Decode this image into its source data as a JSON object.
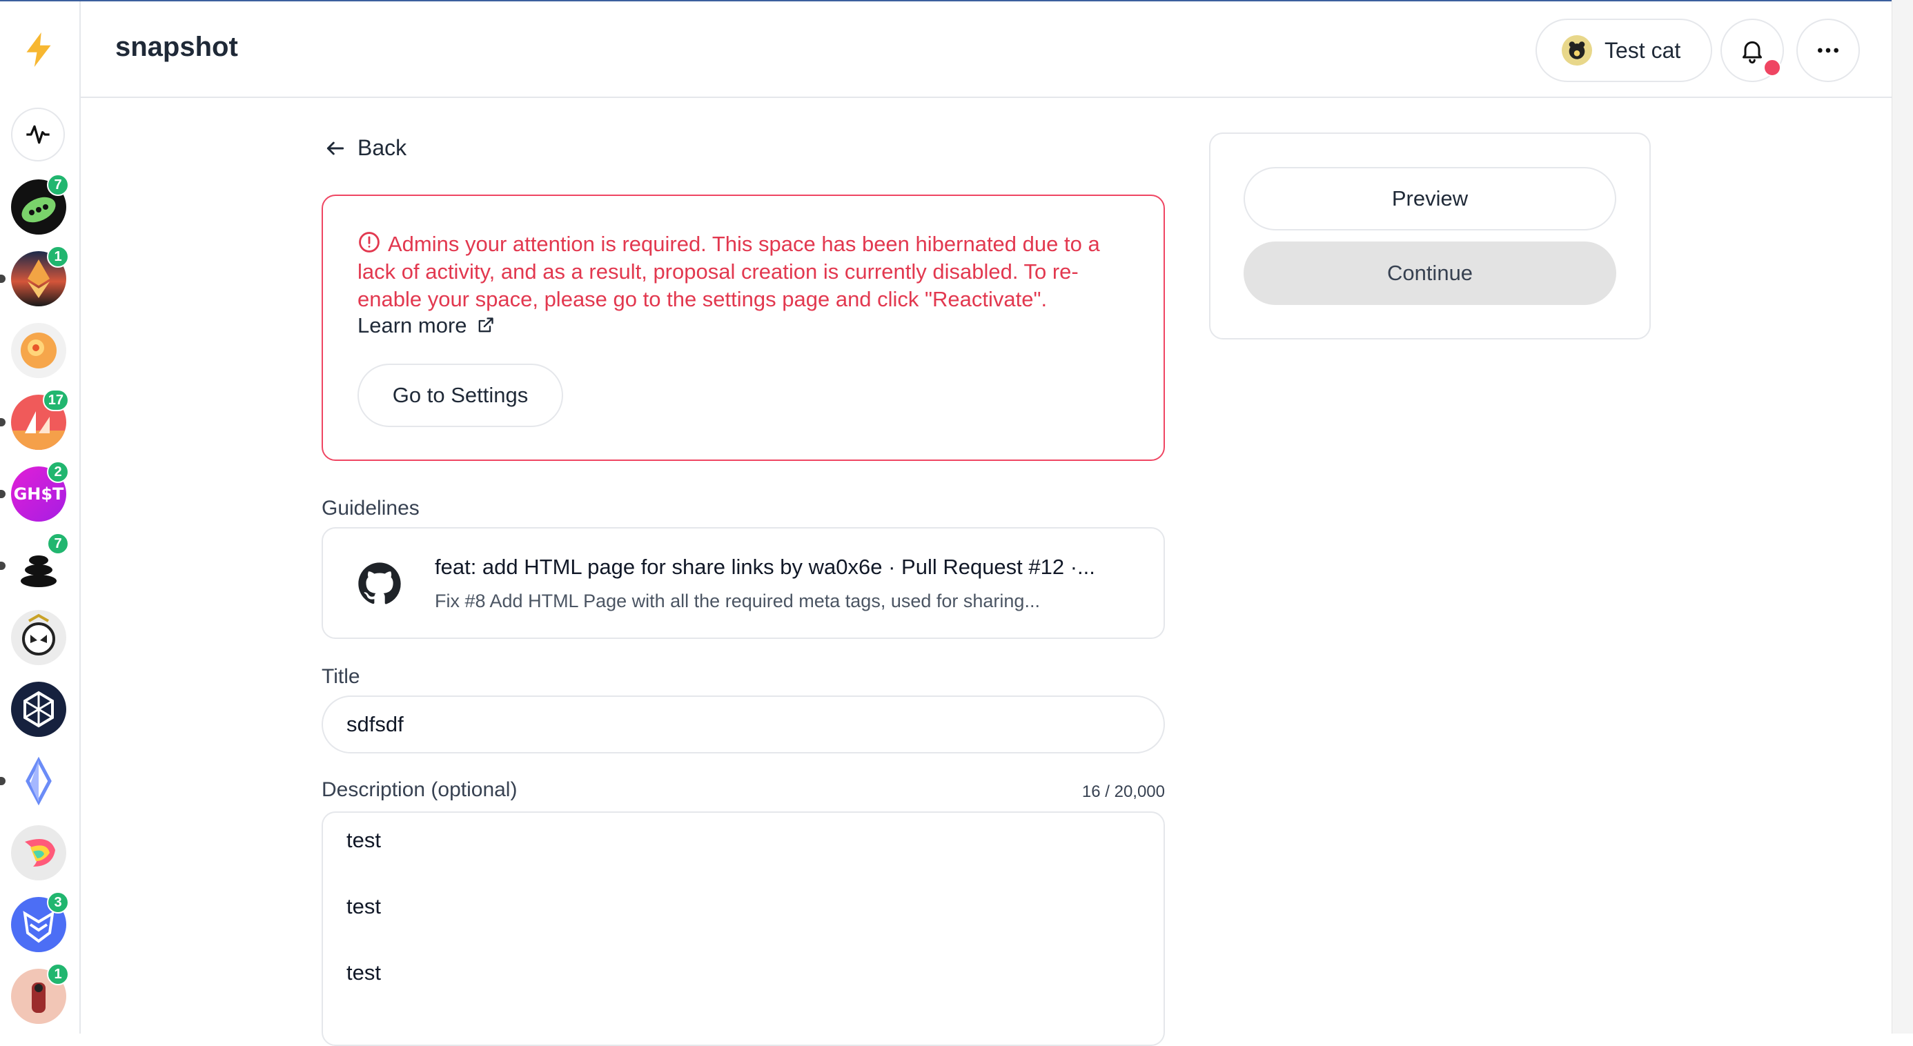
{
  "app": {
    "name": "snapshot"
  },
  "header": {
    "user_name": "Test cat"
  },
  "sidebar": {
    "badges": [
      "7",
      "1",
      "17",
      "2",
      "7",
      "3",
      "1"
    ],
    "ghost_logo_text": "GH$T"
  },
  "back": {
    "label": "Back"
  },
  "alert": {
    "message": "Admins your attention is required. This space has been hibernated due to a lack of activity, and as a result, proposal creation is currently disabled. To re-enable your space, please go to the settings page and click \"Reactivate\".",
    "learn_more": "Learn more",
    "settings_button": "Go to Settings",
    "color": "#e2384f"
  },
  "guidelines": {
    "label": "Guidelines",
    "title": "feat: add HTML page for share links by wa0x6e · Pull Request #12 ·...",
    "subtitle": "Fix #8 Add HTML Page with all the required meta tags, used for sharing..."
  },
  "title_field": {
    "label": "Title",
    "value": "sdfsdf"
  },
  "description": {
    "label": "Description (optional)",
    "counter": "16 / 20,000",
    "lines": [
      "test",
      "test",
      "test"
    ]
  },
  "actions": {
    "preview": "Preview",
    "continue": "Continue"
  }
}
